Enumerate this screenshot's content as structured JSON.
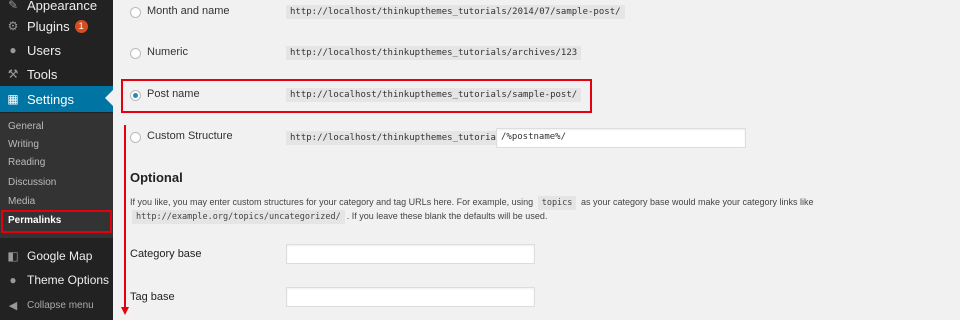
{
  "sidebar": {
    "menu": [
      {
        "label": "Appearance",
        "icon": "paintbrush-icon"
      },
      {
        "label": "Plugins",
        "icon": "plugin-icon",
        "badge": "1"
      },
      {
        "label": "Users",
        "icon": "user-icon"
      },
      {
        "label": "Tools",
        "icon": "wrench-icon"
      },
      {
        "label": "Settings",
        "icon": "settings-icon"
      }
    ],
    "submenu": [
      "General",
      "Writing",
      "Reading",
      "Discussion",
      "Media",
      "Permalinks"
    ],
    "lower": [
      {
        "label": "Google Map",
        "icon": "map-icon"
      },
      {
        "label": "Theme Options",
        "icon": "theme-options-icon"
      }
    ],
    "collapse_label": "Collapse menu",
    "accent_color": "#0074a2"
  },
  "permalinks": {
    "options": [
      {
        "label": "Month and name",
        "example": "http://localhost/thinkupthemes_tutorials/2014/07/sample-post/"
      },
      {
        "label": "Numeric",
        "example": "http://localhost/thinkupthemes_tutorials/archives/123"
      },
      {
        "label": "Post name",
        "example": "http://localhost/thinkupthemes_tutorials/sample-post/",
        "selected": true
      },
      {
        "label": "Custom Structure",
        "example": "http://localhost/thinkupthemes_tutorials",
        "value": "/%postname%/"
      }
    ]
  },
  "optional": {
    "heading": "Optional",
    "desc_part1": "If you like, you may enter custom structures for your category and tag URLs here. For example, using",
    "desc_code1": "topics",
    "desc_part2": "as your category base would make your category links like",
    "desc_code2": "http://example.org/topics/uncategorized/",
    "desc_part3": ". If you leave these blank the defaults will be used.",
    "category_base_label": "Category base",
    "category_base_value": "",
    "tag_base_label": "Tag base",
    "tag_base_value": ""
  },
  "highlight_color": "#e3000f"
}
